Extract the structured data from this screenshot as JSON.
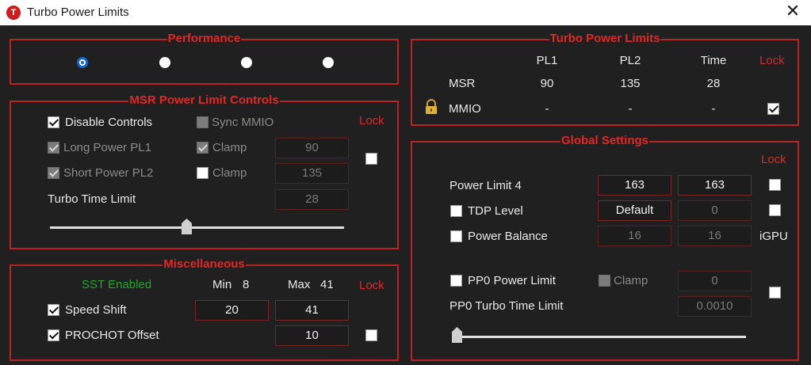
{
  "window": {
    "title": "Turbo Power Limits",
    "app_icon_letter": "T",
    "close_glyph": "✕"
  },
  "performance": {
    "title": "Performance",
    "radio_count": 4,
    "selected": 0
  },
  "msr": {
    "title": "MSR Power Limit Controls",
    "disable_controls": "Disable Controls",
    "sync_mmio": "Sync MMIO",
    "lock": "Lock",
    "long_power": "Long Power PL1",
    "short_power": "Short Power PL2",
    "clamp1": "Clamp",
    "clamp2": "Clamp",
    "pl1_value": "90",
    "pl2_value": "135",
    "turbo_time_label": "Turbo Time Limit",
    "turbo_time_value": "28"
  },
  "misc": {
    "title": "Miscellaneous",
    "sst": "SST Enabled",
    "min_label": "Min",
    "min_value": "8",
    "max_label": "Max",
    "max_value": "41",
    "lock": "Lock",
    "speed_shift": "Speed Shift",
    "speed_min": "20",
    "speed_max": "41",
    "prochot": "PROCHOT Offset",
    "prochot_value": "10"
  },
  "turbo": {
    "title": "Turbo Power Limits",
    "headers": {
      "pl1": "PL1",
      "pl2": "PL2",
      "time": "Time",
      "lock": "Lock"
    },
    "msr": {
      "label": "MSR",
      "pl1": "90",
      "pl2": "135",
      "time": "28"
    },
    "mmio": {
      "label": "MMIO",
      "pl1": "-",
      "pl2": "-",
      "time": "-"
    },
    "mmio_icon": "lock-icon"
  },
  "global": {
    "title": "Global Settings",
    "lock": "Lock",
    "power_limit4": {
      "label": "Power Limit 4",
      "v1": "163",
      "v2": "163"
    },
    "tdp_level": {
      "label": "TDP Level",
      "v1": "Default",
      "v2": "0"
    },
    "power_balance": {
      "label": "Power Balance",
      "v1": "16",
      "v2": "16",
      "suffix": "iGPU"
    },
    "pp0_power": {
      "label": "PP0 Power Limit",
      "clamp": "Clamp",
      "value": "0"
    },
    "pp0_time": {
      "label": "PP0 Turbo Time Limit",
      "value": "0.0010"
    }
  },
  "colors": {
    "accent": "#e32626",
    "border": "#b82424",
    "background": "#202020",
    "green": "#1fa82a",
    "radio": "#1368d0"
  }
}
